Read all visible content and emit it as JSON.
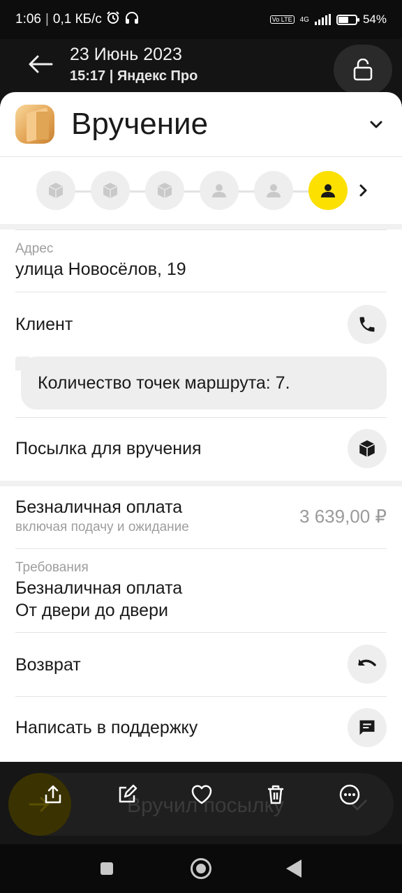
{
  "status_bar": {
    "time": "1:06",
    "network_speed": "0,1 КБ/с",
    "network_type": "4G",
    "volte": "Vo LTE",
    "battery_percent": "54%",
    "battery_level": 0.54
  },
  "header": {
    "date": "23 Июнь 2023",
    "subtitle": "15:17 | Яндекс Про"
  },
  "sheet": {
    "title": "Вручение",
    "stepper": {
      "steps": [
        {
          "icon": "box-icon",
          "active": false
        },
        {
          "icon": "box-icon",
          "active": false
        },
        {
          "icon": "box-icon",
          "active": false
        },
        {
          "icon": "person-icon",
          "active": false
        },
        {
          "icon": "person-icon",
          "active": false
        },
        {
          "icon": "person-icon",
          "active": true
        }
      ]
    },
    "address_label": "Адрес",
    "address_value": "улица Новосёлов, 19",
    "client_label": "Клиент",
    "route_message": "Количество точек маршрута: 7.",
    "parcel_label": "Посылка для вручения",
    "payment_title": "Безналичная оплата",
    "payment_subtitle": "включая подачу и ожидание",
    "payment_amount": "3 639,00 ₽",
    "requirements_label": "Требования",
    "requirements_line1": "Безналичная оплата",
    "requirements_line2": "От двери до двери",
    "return_label": "Возврат",
    "support_label": "Написать в поддержку"
  },
  "bottom": {
    "deliver_button": "Вручил посылку"
  },
  "colors": {
    "accent": "#fce000",
    "muted": "#9e9e9e"
  }
}
